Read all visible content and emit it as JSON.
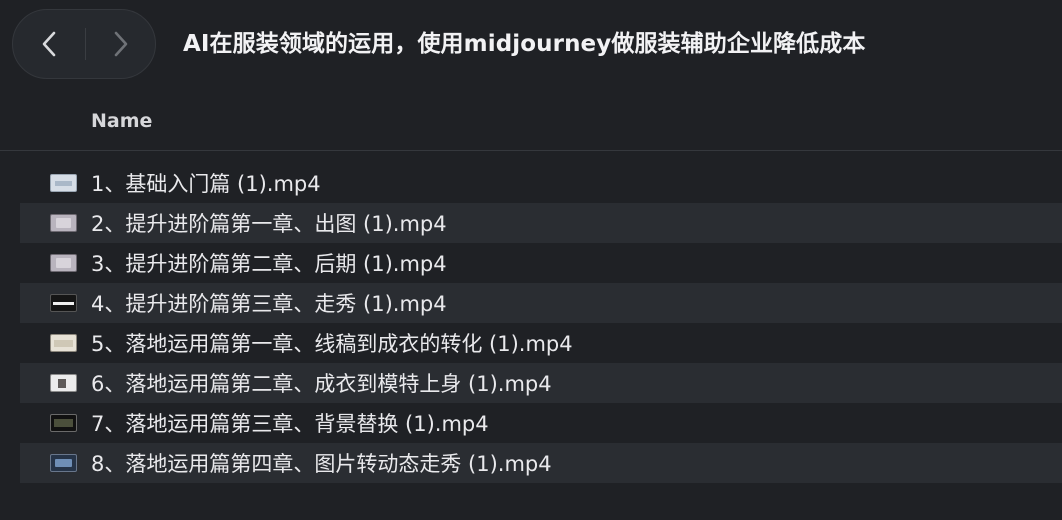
{
  "window": {
    "title": "AI在服装领域的运用，使用midjourney做服装辅助企业降低成本"
  },
  "toolbar": {
    "back_icon": "chevron-left-icon",
    "forward_icon": "chevron-right-icon"
  },
  "list": {
    "column_header": "Name",
    "files": [
      {
        "name": "1、基础入门篇 (1).mp4",
        "thumb_icon": "video-thumbnail-icon"
      },
      {
        "name": "2、提升进阶篇第一章、出图 (1).mp4",
        "thumb_icon": "video-thumbnail-icon"
      },
      {
        "name": "3、提升进阶篇第二章、后期 (1).mp4",
        "thumb_icon": "video-thumbnail-icon"
      },
      {
        "name": "4、提升进阶篇第三章、走秀 (1).mp4",
        "thumb_icon": "video-thumbnail-icon"
      },
      {
        "name": "5、落地运用篇第一章、线稿到成衣的转化 (1).mp4",
        "thumb_icon": "video-thumbnail-icon"
      },
      {
        "name": "6、落地运用篇第二章、成衣到模特上身 (1).mp4",
        "thumb_icon": "video-thumbnail-icon"
      },
      {
        "name": "7、落地运用篇第三章、背景替换 (1).mp4",
        "thumb_icon": "video-thumbnail-icon"
      },
      {
        "name": "8、落地运用篇第四章、图片转动态走秀 (1).mp4",
        "thumb_icon": "video-thumbnail-icon"
      }
    ]
  }
}
